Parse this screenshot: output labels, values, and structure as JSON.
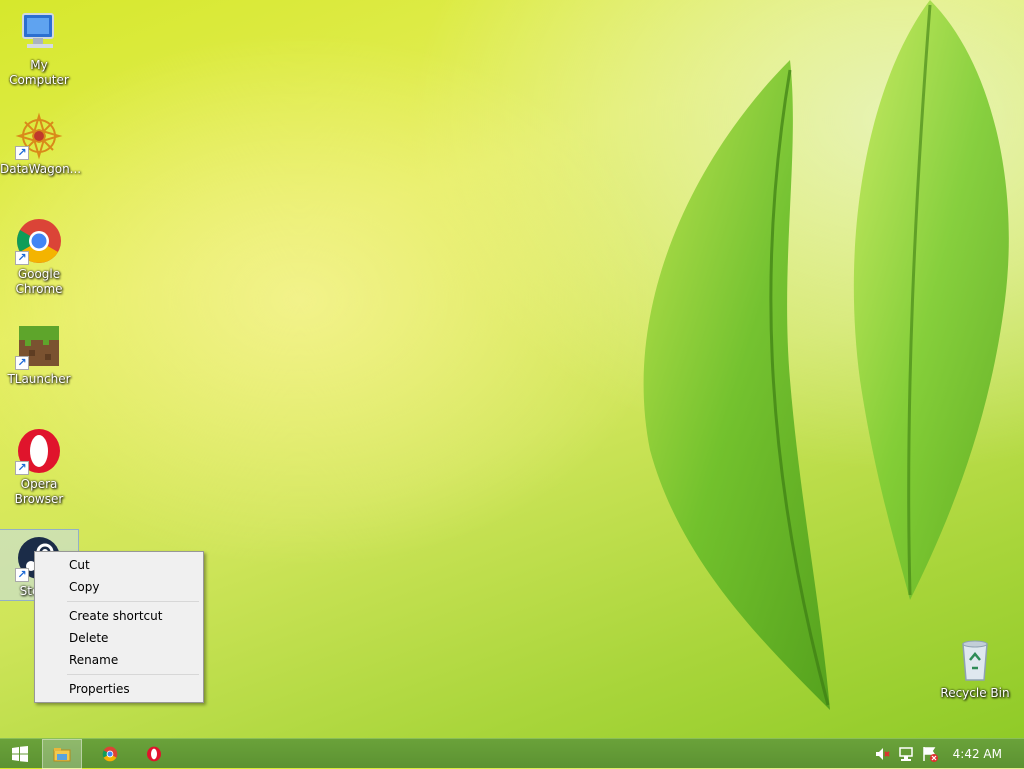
{
  "desktop": {
    "icons": [
      {
        "label": "My Computer"
      },
      {
        "label": "DataWagon..."
      },
      {
        "label": "Google Chrome"
      },
      {
        "label": "TLauncher"
      },
      {
        "label": "Opera Browser"
      },
      {
        "label": "Steam"
      },
      {
        "label": "Recycle Bin"
      }
    ]
  },
  "context_menu": {
    "items": [
      "Cut",
      "Copy",
      "Create shortcut",
      "Delete",
      "Rename",
      "Properties"
    ]
  },
  "taskbar": {
    "pinned": [
      "start-icon",
      "file-explorer-icon",
      "chrome-icon",
      "opera-icon"
    ],
    "tray": [
      "volume-muted-icon",
      "network-icon",
      "action-center-icon"
    ],
    "clock": "4:42 AM"
  },
  "colors": {
    "taskbar": "#5c9232",
    "accent_leaf": "#7cc23a",
    "menu_bg": "#f0f0f0"
  }
}
